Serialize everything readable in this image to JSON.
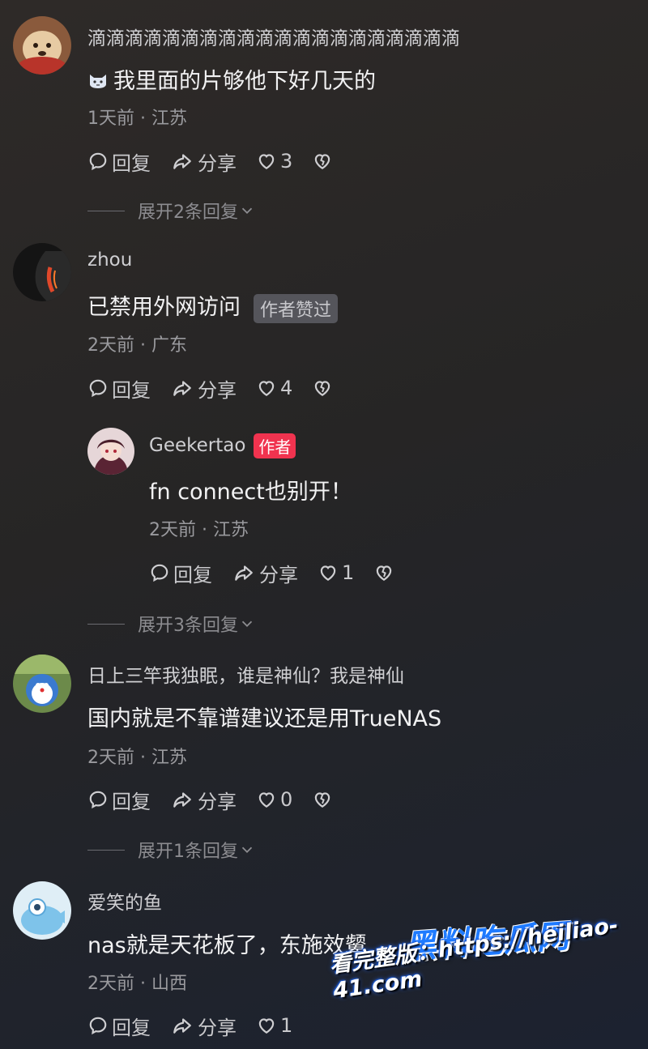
{
  "comments": [
    {
      "username": "滴滴滴滴滴滴滴滴滴滴滴滴滴滴滴滴滴滴滴滴",
      "text": "我里面的片够他下好几天的",
      "emoji_icon": "cat-face-icon",
      "meta": "1天前 · 江苏",
      "reply_label": "回复",
      "share_label": "分享",
      "likes": "3",
      "expand_label": "展开2条回复"
    },
    {
      "username": "zhou",
      "text": "已禁用外网访问",
      "tag": "作者赞过",
      "meta": "2天前 · 广东",
      "reply_label": "回复",
      "share_label": "分享",
      "likes": "4",
      "reply": {
        "username": "Geekertao",
        "author_tag": "作者",
        "text": "fn connect也别开！",
        "meta": "2天前 · 江苏",
        "reply_label": "回复",
        "share_label": "分享",
        "likes": "1"
      },
      "expand_label": "展开3条回复"
    },
    {
      "username": "日上三竿我独眠，谁是神仙？我是神仙",
      "text": "国内就是不靠谱建议还是用TrueNAS",
      "meta": "2天前 · 江苏",
      "reply_label": "回复",
      "share_label": "分享",
      "likes": "0",
      "expand_label": "展开1条回复"
    },
    {
      "username": "爱笑的鱼",
      "text": "nas就是天花板了，东施效颦",
      "meta": "2天前 · 山西",
      "reply_label": "回复",
      "share_label": "分享",
      "likes": "1"
    }
  ],
  "watermark": {
    "logo": "黑料吃瓜网",
    "url_text": "看完整版：https://heiliao-41.com"
  },
  "colors": {
    "author_tag": "#f0334f",
    "liked_tag": "#55555b",
    "text": "#f2f2f3",
    "meta": "#9a9a9e"
  }
}
